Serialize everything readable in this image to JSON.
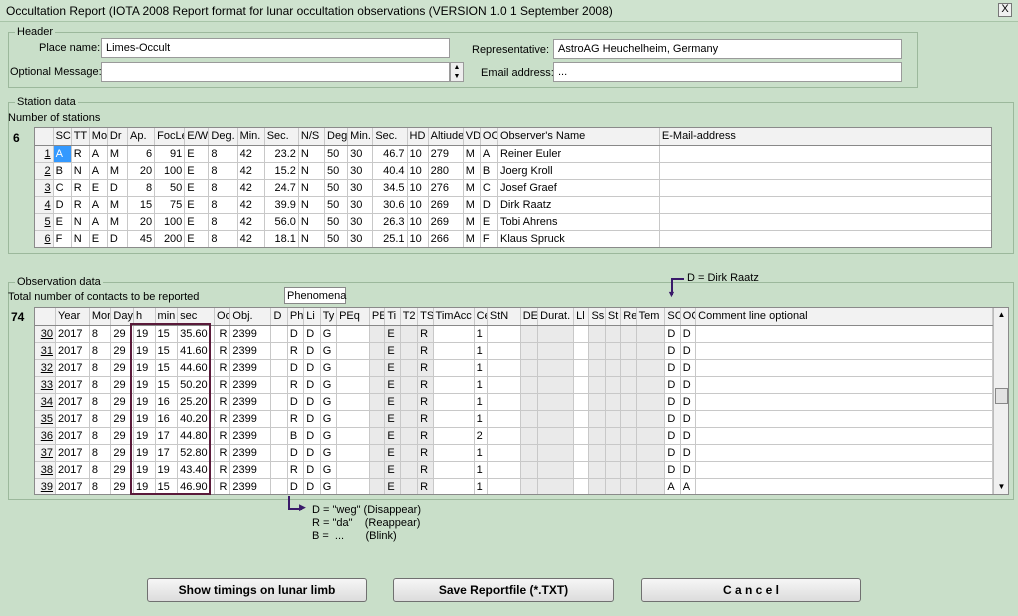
{
  "window": {
    "title": "Occultation Report (IOTA 2008 Report format for lunar occultation observations (VERSION 1.0  1 September 2008)",
    "close": "X"
  },
  "header": {
    "group_label": "Header",
    "place_label": "Place name:",
    "place_value": "Limes-Occult",
    "message_label": "Optional Message:",
    "message_value": "",
    "rep_label": "Representative:",
    "rep_value": "AstroAG Heuchelheim, Germany",
    "email_label": "Email address:",
    "email_value": "..."
  },
  "station": {
    "group_label": "Station data",
    "count_label": "Number of stations",
    "count": "6",
    "columns": [
      "SC",
      "TT",
      "Mo",
      "Dr",
      "Ap.",
      "FocLe",
      "E/W",
      "Deg.",
      "Min.",
      "Sec.",
      "N/S",
      "Deg",
      "Min.",
      "Sec.",
      "HD",
      "Altiude",
      "VD",
      "OC",
      "Observer's Name",
      "E-Mail-address"
    ],
    "rows": [
      [
        "1",
        "A",
        "R",
        "A",
        "M",
        "6",
        "91",
        "E",
        "8",
        "42",
        "23.2",
        "N",
        "50",
        "30",
        "46.7",
        "10",
        "279",
        "M",
        "A",
        "Reiner Euler",
        ""
      ],
      [
        "2",
        "B",
        "N",
        "A",
        "M",
        "20",
        "100",
        "E",
        "8",
        "42",
        "15.2",
        "N",
        "50",
        "30",
        "40.4",
        "10",
        "280",
        "M",
        "B",
        "Joerg Kroll",
        ""
      ],
      [
        "3",
        "C",
        "R",
        "E",
        "D",
        "8",
        "50",
        "E",
        "8",
        "42",
        "24.7",
        "N",
        "50",
        "30",
        "34.5",
        "10",
        "276",
        "M",
        "C",
        "Josef Graef",
        ""
      ],
      [
        "4",
        "D",
        "R",
        "A",
        "M",
        "15",
        "75",
        "E",
        "8",
        "42",
        "39.9",
        "N",
        "50",
        "30",
        "30.6",
        "10",
        "269",
        "M",
        "D",
        "Dirk Raatz",
        ""
      ],
      [
        "5",
        "E",
        "N",
        "A",
        "M",
        "20",
        "100",
        "E",
        "8",
        "42",
        "56.0",
        "N",
        "50",
        "30",
        "26.3",
        "10",
        "269",
        "M",
        "E",
        "Tobi Ahrens",
        ""
      ],
      [
        "6",
        "F",
        "N",
        "E",
        "D",
        "45",
        "200",
        "E",
        "8",
        "42",
        "18.1",
        "N",
        "50",
        "30",
        "25.1",
        "10",
        "266",
        "M",
        "F",
        "Klaus Spruck",
        ""
      ]
    ]
  },
  "observation": {
    "group_label": "Observation data",
    "count_label": "Total number of contacts to be reported",
    "count": "74",
    "phenomena_label": "Phenomena",
    "annotation_top": "D = Dirk Raatz",
    "columns": [
      "Year",
      "Mor",
      "Day",
      "h",
      "min",
      "sec",
      "Oc",
      "Obj.",
      "D",
      "Ph",
      "Li",
      "Ty",
      "PEq",
      "PE",
      "Ti",
      "T2",
      "TS",
      "TimAcc",
      "Ce",
      "StN",
      "DE",
      "Durat.",
      "Ll",
      "Ss",
      "St",
      "Re",
      "Tem",
      "SC",
      "OC",
      "Comment line optional"
    ],
    "rows": [
      [
        "30",
        "2017",
        "8",
        "29",
        "19",
        "15",
        "35.60",
        "R",
        "2399",
        "",
        "D",
        "D",
        "G",
        "",
        "",
        "E",
        "",
        "R",
        "",
        "1",
        "",
        "",
        "",
        "",
        "",
        "",
        "",
        "",
        "D",
        "D",
        ""
      ],
      [
        "31",
        "2017",
        "8",
        "29",
        "19",
        "15",
        "41.60",
        "R",
        "2399",
        "",
        "R",
        "D",
        "G",
        "",
        "",
        "E",
        "",
        "R",
        "",
        "1",
        "",
        "",
        "",
        "",
        "",
        "",
        "",
        "",
        "D",
        "D",
        ""
      ],
      [
        "32",
        "2017",
        "8",
        "29",
        "19",
        "15",
        "44.60",
        "R",
        "2399",
        "",
        "D",
        "D",
        "G",
        "",
        "",
        "E",
        "",
        "R",
        "",
        "1",
        "",
        "",
        "",
        "",
        "",
        "",
        "",
        "",
        "D",
        "D",
        ""
      ],
      [
        "33",
        "2017",
        "8",
        "29",
        "19",
        "15",
        "50.20",
        "R",
        "2399",
        "",
        "R",
        "D",
        "G",
        "",
        "",
        "E",
        "",
        "R",
        "",
        "1",
        "",
        "",
        "",
        "",
        "",
        "",
        "",
        "",
        "D",
        "D",
        ""
      ],
      [
        "34",
        "2017",
        "8",
        "29",
        "19",
        "16",
        "25.20",
        "R",
        "2399",
        "",
        "D",
        "D",
        "G",
        "",
        "",
        "E",
        "",
        "R",
        "",
        "1",
        "",
        "",
        "",
        "",
        "",
        "",
        "",
        "",
        "D",
        "D",
        ""
      ],
      [
        "35",
        "2017",
        "8",
        "29",
        "19",
        "16",
        "40.20",
        "R",
        "2399",
        "",
        "R",
        "D",
        "G",
        "",
        "",
        "E",
        "",
        "R",
        "",
        "1",
        "",
        "",
        "",
        "",
        "",
        "",
        "",
        "",
        "D",
        "D",
        ""
      ],
      [
        "36",
        "2017",
        "8",
        "29",
        "19",
        "17",
        "44.80",
        "R",
        "2399",
        "",
        "B",
        "D",
        "G",
        "",
        "",
        "E",
        "",
        "R",
        "",
        "2",
        "",
        "",
        "",
        "",
        "",
        "",
        "",
        "",
        "D",
        "D",
        ""
      ],
      [
        "37",
        "2017",
        "8",
        "29",
        "19",
        "17",
        "52.80",
        "R",
        "2399",
        "",
        "D",
        "D",
        "G",
        "",
        "",
        "E",
        "",
        "R",
        "",
        "1",
        "",
        "",
        "",
        "",
        "",
        "",
        "",
        "",
        "D",
        "D",
        ""
      ],
      [
        "38",
        "2017",
        "8",
        "29",
        "19",
        "19",
        "43.40",
        "R",
        "2399",
        "",
        "R",
        "D",
        "G",
        "",
        "",
        "E",
        "",
        "R",
        "",
        "1",
        "",
        "",
        "",
        "",
        "",
        "",
        "",
        "",
        "D",
        "D",
        ""
      ],
      [
        "39",
        "2017",
        "8",
        "29",
        "19",
        "15",
        "46.90",
        "R",
        "2399",
        "",
        "D",
        "D",
        "G",
        "",
        "",
        "E",
        "",
        "R",
        "",
        "1",
        "",
        "",
        "",
        "",
        "",
        "",
        "",
        "",
        "A",
        "A",
        ""
      ]
    ]
  },
  "legend": {
    "line1": "D = \"weg\" (Disappear)",
    "line2": "R = \"da\"    (Reappear)",
    "line3": "B =  ...       (Blink)"
  },
  "buttons": {
    "show_timings": "Show timings on lunar limb",
    "save": "Save Reportfile (*.TXT)",
    "cancel": "C a n c e l"
  }
}
